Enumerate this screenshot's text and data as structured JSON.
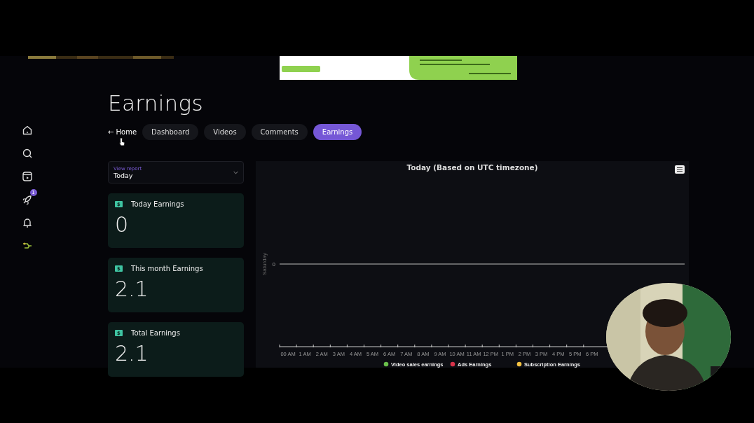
{
  "sidebar": {
    "badge": "1"
  },
  "page": {
    "title": "Earnings"
  },
  "nav": {
    "back": {
      "arrow": "←",
      "label": "Home"
    },
    "tabs": [
      {
        "label": "Dashboard",
        "selected": false
      },
      {
        "label": "Videos",
        "selected": false
      },
      {
        "label": "Comments",
        "selected": false
      },
      {
        "label": "Earnings",
        "selected": true
      }
    ]
  },
  "report_select": {
    "label": "View report",
    "value": "Today"
  },
  "cards": [
    {
      "symbol": "$",
      "title": "Today Earnings",
      "value": "0"
    },
    {
      "symbol": "$",
      "title": "This month Earnings",
      "value": "2.1"
    },
    {
      "symbol": "$",
      "title": "Total Earnings",
      "value": "2.1"
    }
  ],
  "chart": {
    "title": "Today (Based on UTC timezone)",
    "ylabel": "Saturday",
    "y_tick": "0",
    "x_labels": [
      "00 AM",
      "1 AM",
      "2 AM",
      "3 AM",
      "4 AM",
      "5 AM",
      "6 AM",
      "7 AM",
      "8 AM",
      "9 AM",
      "10 AM",
      "11 AM",
      "12 PM",
      "1 PM",
      "2 PM",
      "3 PM",
      "4 PM",
      "5 PM",
      "6 PM"
    ],
    "legend": [
      {
        "name": "Video sales earnings",
        "color": "#6abf4b"
      },
      {
        "name": "Ads Earnings",
        "color": "#d9334a"
      },
      {
        "name": "Subscription Earnings",
        "color": "#f5c242"
      }
    ]
  }
}
